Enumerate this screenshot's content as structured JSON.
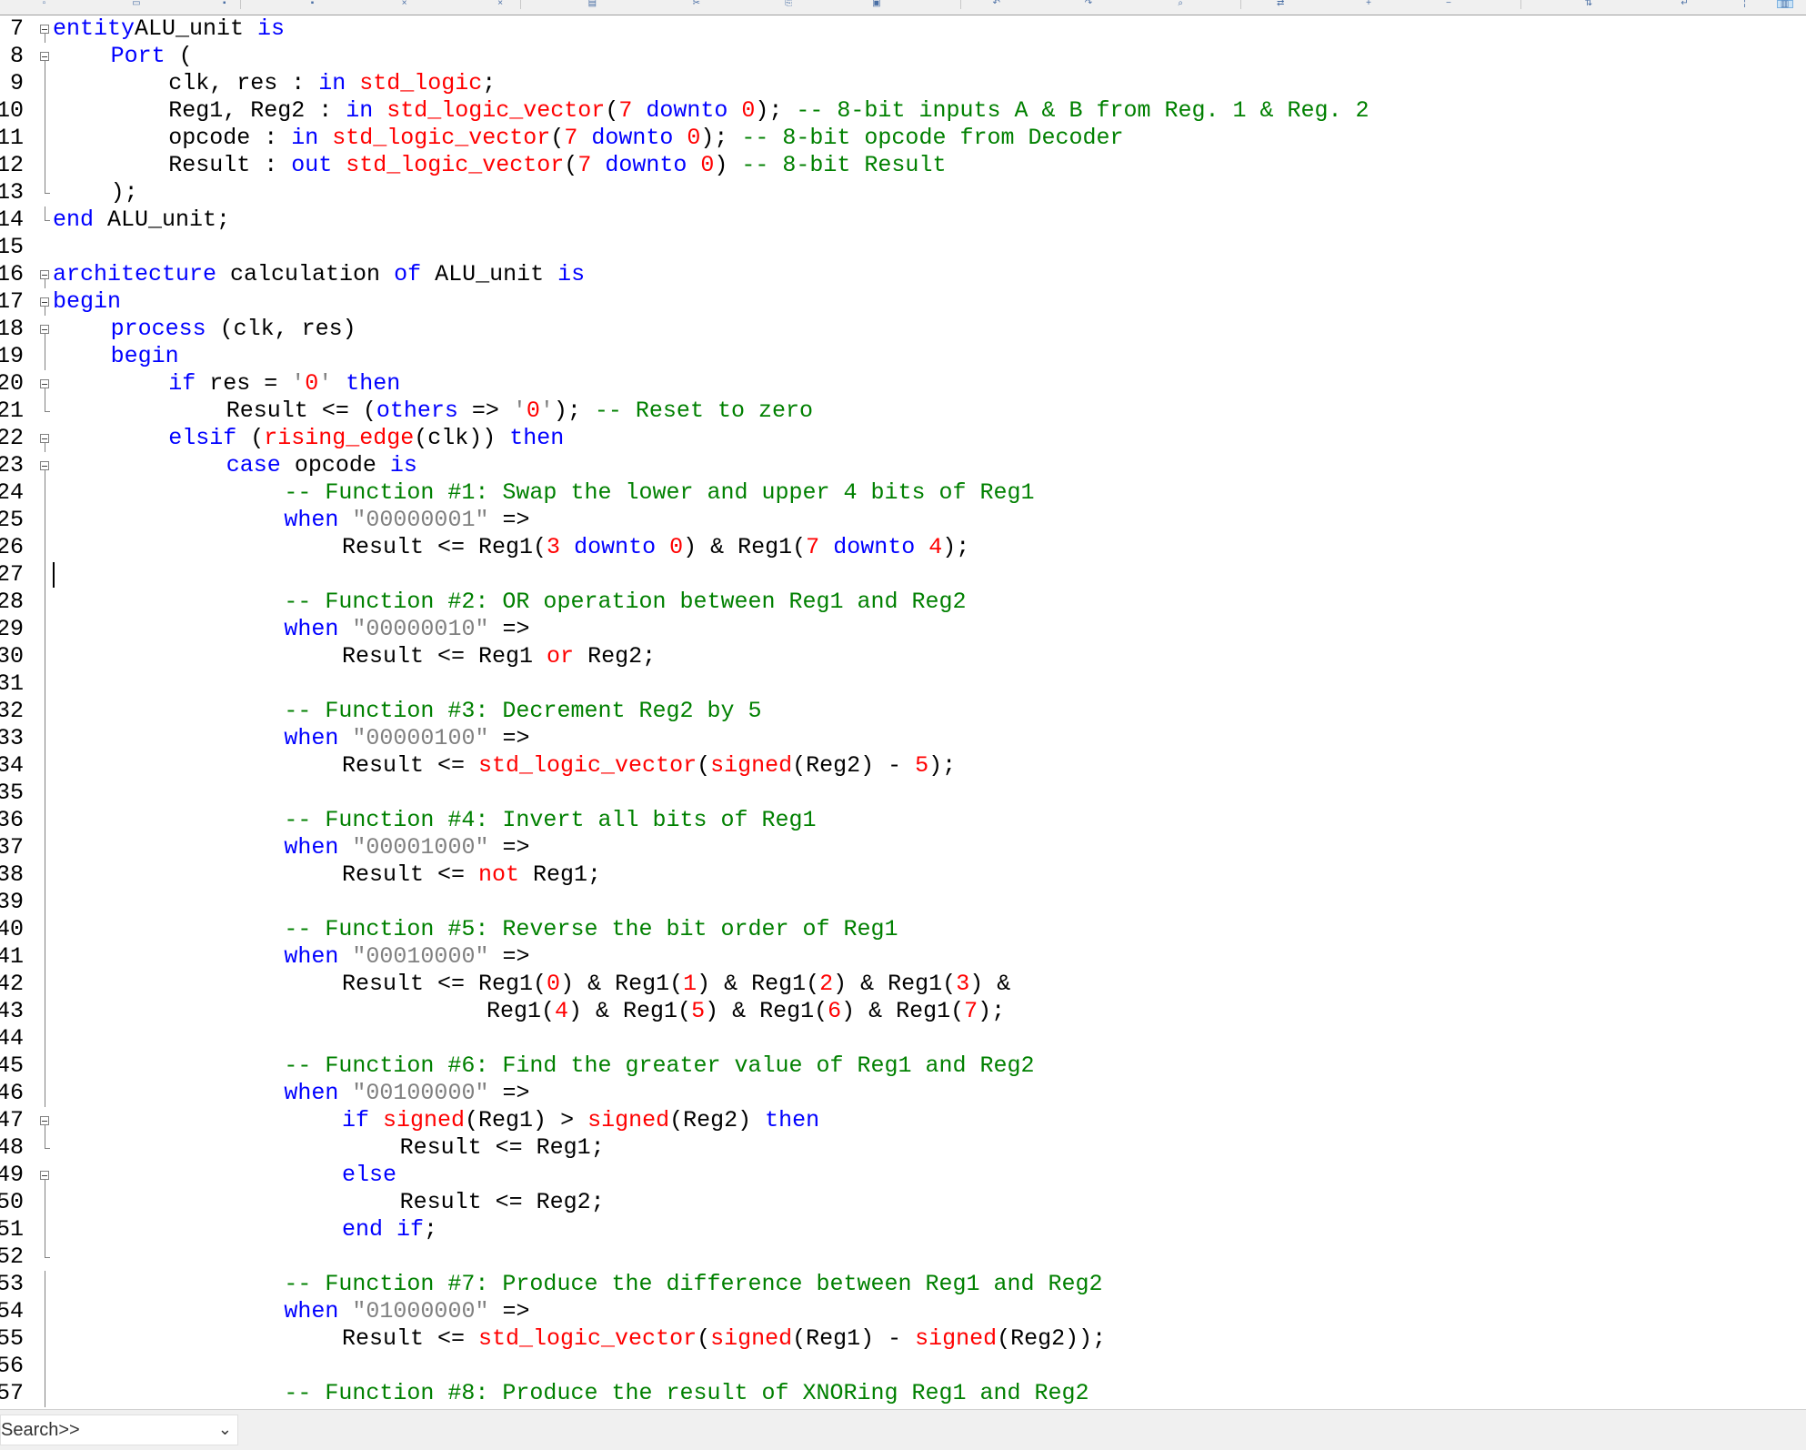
{
  "toolbar": {
    "icons": [
      "new-file-icon",
      "open-file-icon",
      "save-icon",
      "save-all-icon",
      "close-icon",
      "close-all-icon",
      "print-icon",
      "cut-icon",
      "copy-icon",
      "paste-icon",
      "undo-icon",
      "redo-icon",
      "find-icon",
      "replace-icon",
      "zoom-in-icon",
      "zoom-out-icon",
      "sync-scroll-icon",
      "wrap-icon",
      "indent-guide-icon",
      "doc-map-icon"
    ]
  },
  "editor": {
    "lines": [
      {
        "n": "7",
        "tokens": [
          [
            "kw",
            "entity"
          ],
          [
            "",
            "ALU_unit "
          ],
          [
            "kw",
            "is"
          ]
        ],
        "ind": 0,
        "fold": "box"
      },
      {
        "n": "8",
        "tokens": [
          [
            "kw",
            "Port"
          ],
          [
            "",
            " ("
          ]
        ],
        "ind": 4,
        "fold": "box"
      },
      {
        "n": "9",
        "tokens": [
          [
            "",
            "clk, res : "
          ],
          [
            "kw",
            "in"
          ],
          [
            "",
            " "
          ],
          [
            "ty",
            "std_logic"
          ],
          [
            "",
            ";"
          ]
        ],
        "ind": 8,
        "fold": "line"
      },
      {
        "n": "10",
        "tokens": [
          [
            "",
            "Reg1, Reg2 : "
          ],
          [
            "kw",
            "in"
          ],
          [
            "",
            " "
          ],
          [
            "ty",
            "std_logic_vector"
          ],
          [
            "",
            "("
          ],
          [
            "num",
            "7"
          ],
          [
            "",
            " "
          ],
          [
            "kw",
            "downto"
          ],
          [
            "",
            " "
          ],
          [
            "num",
            "0"
          ],
          [
            "",
            "); "
          ],
          [
            "cm",
            "-- 8-bit inputs A & B from Reg. 1 & Reg. 2"
          ]
        ],
        "ind": 8,
        "fold": "line"
      },
      {
        "n": "11",
        "tokens": [
          [
            "",
            "opcode : "
          ],
          [
            "kw",
            "in"
          ],
          [
            "",
            " "
          ],
          [
            "ty",
            "std_logic_vector"
          ],
          [
            "",
            "("
          ],
          [
            "num",
            "7"
          ],
          [
            "",
            " "
          ],
          [
            "kw",
            "downto"
          ],
          [
            "",
            " "
          ],
          [
            "num",
            "0"
          ],
          [
            "",
            "); "
          ],
          [
            "cm",
            "-- 8-bit opcode from Decoder"
          ]
        ],
        "ind": 8,
        "fold": "line"
      },
      {
        "n": "12",
        "tokens": [
          [
            "",
            "Result : "
          ],
          [
            "kw",
            "out"
          ],
          [
            "",
            " "
          ],
          [
            "ty",
            "std_logic_vector"
          ],
          [
            "",
            "("
          ],
          [
            "num",
            "7"
          ],
          [
            "",
            " "
          ],
          [
            "kw",
            "downto"
          ],
          [
            "",
            " "
          ],
          [
            "num",
            "0"
          ],
          [
            "",
            ") "
          ],
          [
            "cm",
            "-- 8-bit Result"
          ]
        ],
        "ind": 8,
        "fold": "line"
      },
      {
        "n": "13",
        "tokens": [
          [
            "",
            ");"
          ]
        ],
        "ind": 4,
        "fold": "end"
      },
      {
        "n": "14",
        "tokens": [
          [
            "kw",
            "end"
          ],
          [
            "",
            " ALU_unit;"
          ]
        ],
        "ind": 0,
        "fold": "end"
      },
      {
        "n": "15",
        "tokens": [],
        "ind": 0,
        "fold": "none"
      },
      {
        "n": "16",
        "tokens": [
          [
            "kw",
            "architecture"
          ],
          [
            "",
            " calculation "
          ],
          [
            "kw",
            "of"
          ],
          [
            "",
            " ALU_unit "
          ],
          [
            "kw",
            "is"
          ]
        ],
        "ind": 0,
        "fold": "box"
      },
      {
        "n": "17",
        "tokens": [
          [
            "kw",
            "begin"
          ]
        ],
        "ind": 0,
        "fold": "box"
      },
      {
        "n": "18",
        "tokens": [
          [
            "kw",
            "process"
          ],
          [
            "",
            " (clk, res)"
          ]
        ],
        "ind": 4,
        "fold": "box"
      },
      {
        "n": "19",
        "tokens": [
          [
            "kw",
            "begin"
          ]
        ],
        "ind": 4,
        "fold": "line"
      },
      {
        "n": "20",
        "tokens": [
          [
            "kw",
            "if"
          ],
          [
            "",
            " res = "
          ],
          [
            "str",
            "'"
          ],
          [
            "num",
            "0"
          ],
          [
            "str",
            "'"
          ],
          [
            "",
            " "
          ],
          [
            "kw",
            "then"
          ]
        ],
        "ind": 8,
        "fold": "box"
      },
      {
        "n": "21",
        "tokens": [
          [
            "",
            "Result <= ("
          ],
          [
            "kw",
            "others"
          ],
          [
            "",
            " => "
          ],
          [
            "str",
            "'"
          ],
          [
            "num",
            "0"
          ],
          [
            "str",
            "'"
          ],
          [
            "",
            "); "
          ],
          [
            "cm",
            "-- Reset to zero"
          ]
        ],
        "ind": 12,
        "fold": "end"
      },
      {
        "n": "22",
        "tokens": [
          [
            "kw",
            "elsif"
          ],
          [
            "",
            " ("
          ],
          [
            "ty",
            "rising_edge"
          ],
          [
            "",
            "(clk)) "
          ],
          [
            "kw",
            "then"
          ]
        ],
        "ind": 8,
        "fold": "box"
      },
      {
        "n": "23",
        "tokens": [
          [
            "kw",
            "case"
          ],
          [
            "",
            " opcode "
          ],
          [
            "kw",
            "is"
          ]
        ],
        "ind": 12,
        "fold": "box"
      },
      {
        "n": "24",
        "tokens": [
          [
            "cm",
            "-- Function #1: Swap the lower and upper 4 bits of Reg1"
          ]
        ],
        "ind": 16,
        "fold": "line"
      },
      {
        "n": "25",
        "tokens": [
          [
            "kw",
            "when"
          ],
          [
            "",
            " "
          ],
          [
            "str",
            "\"00000001\""
          ],
          [
            "",
            " =>"
          ]
        ],
        "ind": 16,
        "fold": "line"
      },
      {
        "n": "26",
        "tokens": [
          [
            "",
            "Result <= Reg1("
          ],
          [
            "num",
            "3"
          ],
          [
            "",
            " "
          ],
          [
            "kw",
            "downto"
          ],
          [
            "",
            " "
          ],
          [
            "num",
            "0"
          ],
          [
            "",
            ") & Reg1("
          ],
          [
            "num",
            "7"
          ],
          [
            "",
            " "
          ],
          [
            "kw",
            "downto"
          ],
          [
            "",
            " "
          ],
          [
            "num",
            "4"
          ],
          [
            "",
            ");"
          ]
        ],
        "ind": 20,
        "fold": "line"
      },
      {
        "n": "27",
        "tokens": [],
        "ind": 0,
        "fold": "line",
        "caret": true
      },
      {
        "n": "28",
        "tokens": [
          [
            "cm",
            "-- Function #2: OR operation between Reg1 and Reg2"
          ]
        ],
        "ind": 16,
        "fold": "line"
      },
      {
        "n": "29",
        "tokens": [
          [
            "kw",
            "when"
          ],
          [
            "",
            " "
          ],
          [
            "str",
            "\"00000010\""
          ],
          [
            "",
            " =>"
          ]
        ],
        "ind": 16,
        "fold": "line"
      },
      {
        "n": "30",
        "tokens": [
          [
            "",
            "Result <= Reg1 "
          ],
          [
            "ty",
            "or"
          ],
          [
            "",
            " Reg2;"
          ]
        ],
        "ind": 20,
        "fold": "line"
      },
      {
        "n": "31",
        "tokens": [],
        "ind": 0,
        "fold": "line"
      },
      {
        "n": "32",
        "tokens": [
          [
            "cm",
            "-- Function #3: Decrement Reg2 by 5"
          ]
        ],
        "ind": 16,
        "fold": "line"
      },
      {
        "n": "33",
        "tokens": [
          [
            "kw",
            "when"
          ],
          [
            "",
            " "
          ],
          [
            "str",
            "\"00000100\""
          ],
          [
            "",
            " =>"
          ]
        ],
        "ind": 16,
        "fold": "line"
      },
      {
        "n": "34",
        "tokens": [
          [
            "",
            "Result <= "
          ],
          [
            "ty",
            "std_logic_vector"
          ],
          [
            "",
            "("
          ],
          [
            "ty",
            "signed"
          ],
          [
            "",
            "(Reg2) - "
          ],
          [
            "num",
            "5"
          ],
          [
            "",
            ");"
          ]
        ],
        "ind": 20,
        "fold": "line"
      },
      {
        "n": "35",
        "tokens": [],
        "ind": 0,
        "fold": "line"
      },
      {
        "n": "36",
        "tokens": [
          [
            "cm",
            "-- Function #4: Invert all bits of Reg1"
          ]
        ],
        "ind": 16,
        "fold": "line"
      },
      {
        "n": "37",
        "tokens": [
          [
            "kw",
            "when"
          ],
          [
            "",
            " "
          ],
          [
            "str",
            "\"00001000\""
          ],
          [
            "",
            " =>"
          ]
        ],
        "ind": 16,
        "fold": "line"
      },
      {
        "n": "38",
        "tokens": [
          [
            "",
            "Result <= "
          ],
          [
            "ty",
            "not"
          ],
          [
            "",
            " Reg1;"
          ]
        ],
        "ind": 20,
        "fold": "line"
      },
      {
        "n": "39",
        "tokens": [],
        "ind": 0,
        "fold": "line"
      },
      {
        "n": "40",
        "tokens": [
          [
            "cm",
            "-- Function #5: Reverse the bit order of Reg1"
          ]
        ],
        "ind": 16,
        "fold": "line"
      },
      {
        "n": "41",
        "tokens": [
          [
            "kw",
            "when"
          ],
          [
            "",
            " "
          ],
          [
            "str",
            "\"00010000\""
          ],
          [
            "",
            " =>"
          ]
        ],
        "ind": 16,
        "fold": "line"
      },
      {
        "n": "42",
        "tokens": [
          [
            "",
            "Result <= Reg1("
          ],
          [
            "num",
            "0"
          ],
          [
            "",
            ") & Reg1("
          ],
          [
            "num",
            "1"
          ],
          [
            "",
            ") & Reg1("
          ],
          [
            "num",
            "2"
          ],
          [
            "",
            ") & Reg1("
          ],
          [
            "num",
            "3"
          ],
          [
            "",
            ") &"
          ]
        ],
        "ind": 20,
        "fold": "line"
      },
      {
        "n": "43",
        "tokens": [
          [
            "",
            "Reg1("
          ],
          [
            "num",
            "4"
          ],
          [
            "",
            ") & Reg1("
          ],
          [
            "num",
            "5"
          ],
          [
            "",
            ") & Reg1("
          ],
          [
            "num",
            "6"
          ],
          [
            "",
            ") & Reg1("
          ],
          [
            "num",
            "7"
          ],
          [
            "",
            ");"
          ]
        ],
        "ind": 30,
        "fold": "line"
      },
      {
        "n": "44",
        "tokens": [],
        "ind": 0,
        "fold": "line"
      },
      {
        "n": "45",
        "tokens": [
          [
            "cm",
            "-- Function #6: Find the greater value of Reg1 and Reg2"
          ]
        ],
        "ind": 16,
        "fold": "line"
      },
      {
        "n": "46",
        "tokens": [
          [
            "kw",
            "when"
          ],
          [
            "",
            " "
          ],
          [
            "str",
            "\"00100000\""
          ],
          [
            "",
            " =>"
          ]
        ],
        "ind": 16,
        "fold": "line"
      },
      {
        "n": "47",
        "tokens": [
          [
            "kw",
            "if"
          ],
          [
            "",
            " "
          ],
          [
            "ty",
            "signed"
          ],
          [
            "",
            "(Reg1) > "
          ],
          [
            "ty",
            "signed"
          ],
          [
            "",
            "(Reg2) "
          ],
          [
            "kw",
            "then"
          ]
        ],
        "ind": 20,
        "fold": "box"
      },
      {
        "n": "48",
        "tokens": [
          [
            "",
            "Result <= Reg1;"
          ]
        ],
        "ind": 24,
        "fold": "end"
      },
      {
        "n": "49",
        "tokens": [
          [
            "kw",
            "else"
          ]
        ],
        "ind": 20,
        "fold": "box"
      },
      {
        "n": "50",
        "tokens": [
          [
            "",
            "Result <= Reg2;"
          ]
        ],
        "ind": 24,
        "fold": "line"
      },
      {
        "n": "51",
        "tokens": [
          [
            "kw",
            "end"
          ],
          [
            "",
            " "
          ],
          [
            "kw",
            "if"
          ],
          [
            "",
            ";"
          ]
        ],
        "ind": 20,
        "fold": "line"
      },
      {
        "n": "52",
        "tokens": [],
        "ind": 0,
        "fold": "end"
      },
      {
        "n": "53",
        "tokens": [
          [
            "cm",
            "-- Function #7: Produce the difference between Reg1 and Reg2"
          ]
        ],
        "ind": 16,
        "fold": "line"
      },
      {
        "n": "54",
        "tokens": [
          [
            "kw",
            "when"
          ],
          [
            "",
            " "
          ],
          [
            "str",
            "\"01000000\""
          ],
          [
            "",
            " =>"
          ]
        ],
        "ind": 16,
        "fold": "line"
      },
      {
        "n": "55",
        "tokens": [
          [
            "",
            "Result <= "
          ],
          [
            "ty",
            "std_logic_vector"
          ],
          [
            "",
            "("
          ],
          [
            "ty",
            "signed"
          ],
          [
            "",
            "(Reg1) - "
          ],
          [
            "ty",
            "signed"
          ],
          [
            "",
            "(Reg2));"
          ]
        ],
        "ind": 20,
        "fold": "line"
      },
      {
        "n": "56",
        "tokens": [],
        "ind": 0,
        "fold": "line"
      },
      {
        "n": "57",
        "tokens": [
          [
            "cm",
            "-- Function #8: Produce the result of XNORing Reg1 and Reg2"
          ]
        ],
        "ind": 16,
        "fold": "line"
      }
    ]
  },
  "status": {
    "search_label": "Search>>",
    "chevron": "⌄"
  },
  "colors": {
    "keyword": "#0000ff",
    "type": "#ff0000",
    "comment": "#008000",
    "string": "#808080",
    "background": "#ffffff"
  }
}
